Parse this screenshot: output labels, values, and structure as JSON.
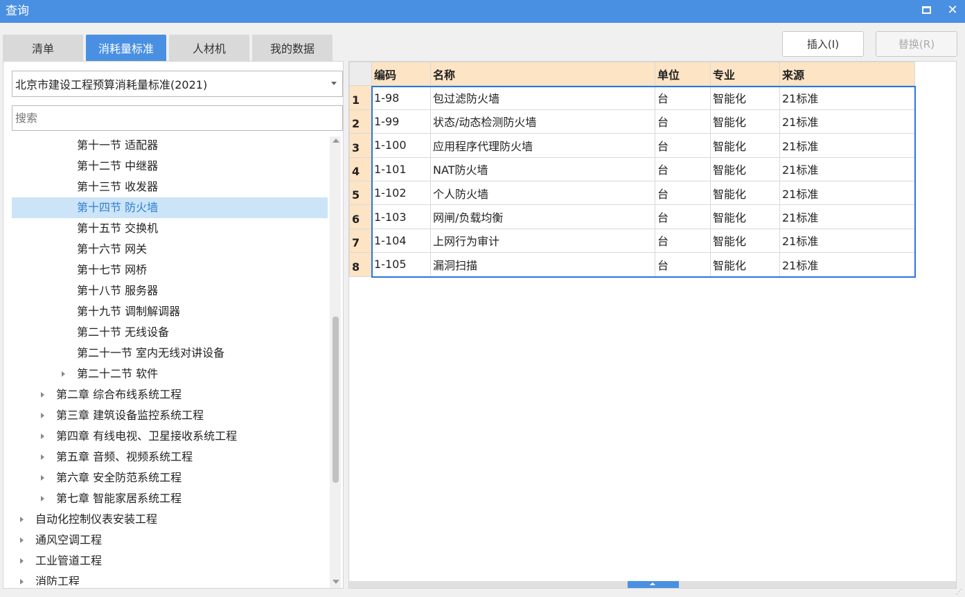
{
  "window": {
    "title": "查询"
  },
  "tabs": [
    {
      "label": "清单"
    },
    {
      "label": "消耗量标准"
    },
    {
      "label": "人材机"
    },
    {
      "label": "我的数据"
    }
  ],
  "actions": {
    "insert_label": "插入(I)",
    "replace_label": "替换(R)"
  },
  "left": {
    "dropdown_value": "北京市建设工程预算消耗量标准(2021)",
    "search_placeholder": "搜索",
    "tree": [
      {
        "label": "第十一节 适配器",
        "expandable": false
      },
      {
        "label": "第十二节 中继器",
        "expandable": false
      },
      {
        "label": "第十三节 收发器",
        "expandable": false
      },
      {
        "label": "第十四节 防火墙",
        "expandable": false,
        "selected": true
      },
      {
        "label": "第十五节 交换机",
        "expandable": false
      },
      {
        "label": "第十六节 网关",
        "expandable": false
      },
      {
        "label": "第十七节 网桥",
        "expandable": false
      },
      {
        "label": "第十八节 服务器",
        "expandable": false
      },
      {
        "label": "第十九节 调制解调器",
        "expandable": false
      },
      {
        "label": "第二十节 无线设备",
        "expandable": false
      },
      {
        "label": "第二十一节 室内无线对讲设备",
        "expandable": false
      },
      {
        "label": "第二十二节 软件",
        "expandable": true
      },
      {
        "label": "第二章 综合布线系统工程",
        "expandable": true
      },
      {
        "label": "第三章 建筑设备监控系统工程",
        "expandable": true
      },
      {
        "label": "第四章 有线电视、卫星接收系统工程",
        "expandable": true
      },
      {
        "label": "第五章 音频、视频系统工程",
        "expandable": true
      },
      {
        "label": "第六章 安全防范系统工程",
        "expandable": true
      },
      {
        "label": "第七章 智能家居系统工程",
        "expandable": true
      },
      {
        "label": "自动化控制仪表安装工程",
        "expandable": true
      },
      {
        "label": "通风空调工程",
        "expandable": true
      },
      {
        "label": "工业管道工程",
        "expandable": true
      },
      {
        "label": "消防工程",
        "expandable": true
      }
    ]
  },
  "table": {
    "columns": [
      "编码",
      "名称",
      "单位",
      "专业",
      "来源"
    ],
    "rows": [
      {
        "num": "1",
        "code": "1-98",
        "name": "包过滤防火墙",
        "unit": "台",
        "major": "智能化",
        "source": "21标准"
      },
      {
        "num": "2",
        "code": "1-99",
        "name": "状态/动态检测防火墙",
        "unit": "台",
        "major": "智能化",
        "source": "21标准"
      },
      {
        "num": "3",
        "code": "1-100",
        "name": "应用程序代理防火墙",
        "unit": "台",
        "major": "智能化",
        "source": "21标准"
      },
      {
        "num": "4",
        "code": "1-101",
        "name": "NAT防火墙",
        "unit": "台",
        "major": "智能化",
        "source": "21标准"
      },
      {
        "num": "5",
        "code": "1-102",
        "name": "个人防火墙",
        "unit": "台",
        "major": "智能化",
        "source": "21标准"
      },
      {
        "num": "6",
        "code": "1-103",
        "name": "网闸/负载均衡",
        "unit": "台",
        "major": "智能化",
        "source": "21标准"
      },
      {
        "num": "7",
        "code": "1-104",
        "name": "上网行为审计",
        "unit": "台",
        "major": "智能化",
        "source": "21标准"
      },
      {
        "num": "8",
        "code": "1-105",
        "name": "漏洞扫描",
        "unit": "台",
        "major": "智能化",
        "source": "21标准"
      }
    ]
  },
  "colors": {
    "accent": "#4a90e2",
    "header_bg": "#fce4c4",
    "selected_bg": "#cce4f7",
    "selected_text": "#2e7fd0"
  }
}
